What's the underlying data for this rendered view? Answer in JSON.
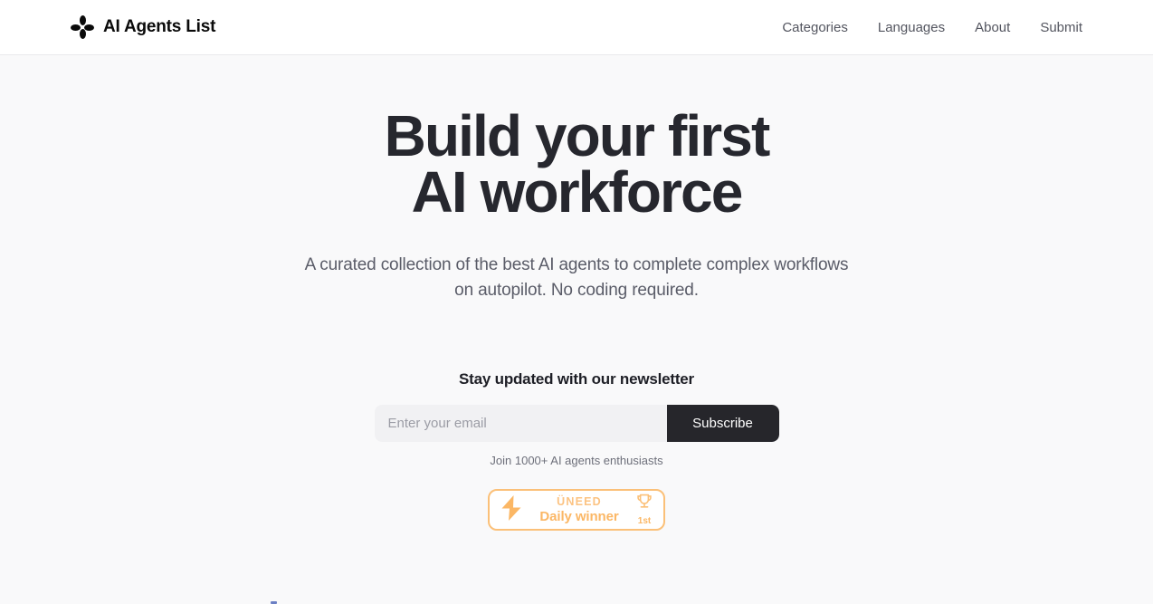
{
  "colors": {
    "page_background": "#f9f9fa",
    "header_background": "#ffffff",
    "heading": "#26272e",
    "body_text": "#5a5c68",
    "nav_link": "#53555f",
    "button_dark": "#26262b",
    "input_background": "#f1f1f3",
    "badge_accent": "#fbc078",
    "badge_text": "#fbb765"
  },
  "header": {
    "brand": {
      "logo_icon": "four-petal-diamond-icon",
      "name": "AI Agents List"
    },
    "nav": [
      {
        "label": "Categories"
      },
      {
        "label": "Languages"
      },
      {
        "label": "About"
      },
      {
        "label": "Submit"
      }
    ]
  },
  "hero": {
    "title_line_1": "Build your first",
    "title_line_2": "AI workforce",
    "subtitle": "A curated collection of the best AI agents to complete complex workflows on autopilot. No coding required."
  },
  "newsletter": {
    "title": "Stay updated with our newsletter",
    "email_placeholder": "Enter your email",
    "email_value": "",
    "subscribe_label": "Subscribe",
    "note": "Join 1000+ AI agents enthusiasts"
  },
  "badge": {
    "bolt_icon": "lightning-bolt-icon",
    "brand": "ÜNEED",
    "tagline": "Daily winner",
    "trophy_icon": "trophy-icon",
    "rank": "1st"
  }
}
